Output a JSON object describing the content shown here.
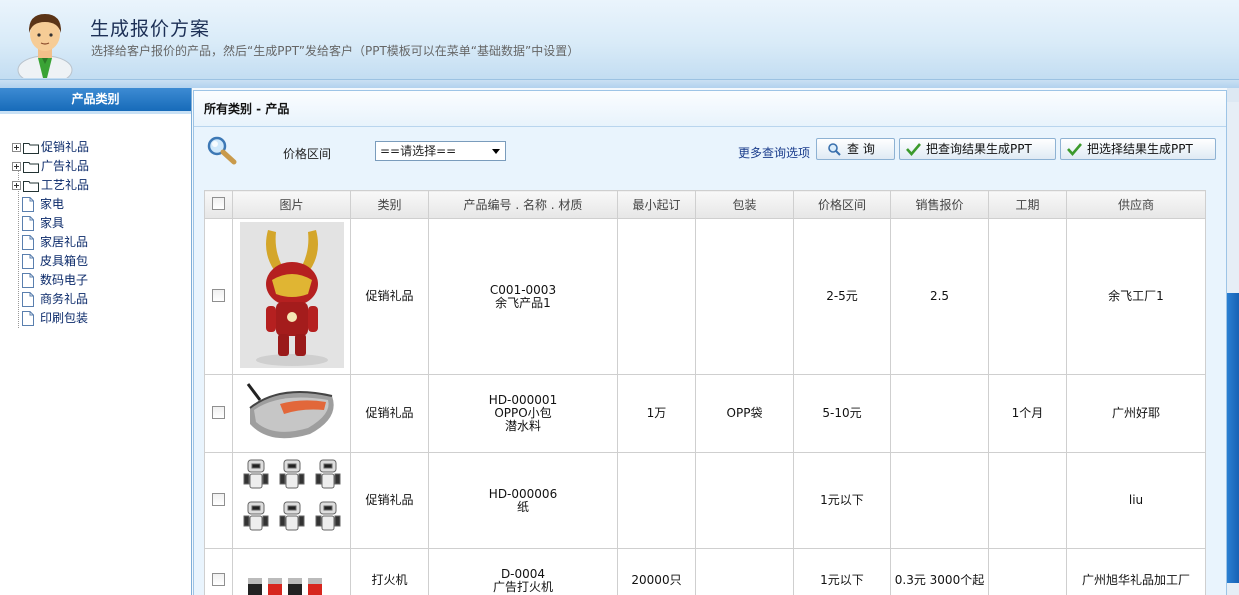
{
  "header": {
    "title": "生成报价方案",
    "subtitle": "选择给客户报价的产品，然后“生成PPT”发给客户（PPT模板可以在菜单“基础数据”中设置）"
  },
  "sidebar": {
    "title": "产品类别",
    "roots": [
      "促销礼品",
      "广告礼品",
      "工艺礼品"
    ],
    "children": [
      "家电",
      "家具",
      "家居礼品",
      "皮具箱包",
      "数码电子",
      "商务礼品",
      "印刷包装"
    ]
  },
  "main": {
    "breadcrumb": "所有类别 - 产品",
    "filter": {
      "price_label": "价格区间",
      "price_select_value": "==请选择==",
      "more_query": "更多查询选项",
      "query_button": "查 询",
      "ppt_from_query_button": "把查询结果生成PPT",
      "ppt_from_selection_button": "把选择结果生成PPT"
    },
    "table": {
      "headers": [
        "图片",
        "类别",
        "产品编号 . 名称 . 材质",
        "最小起订",
        "包装",
        "价格区间",
        "销售报价",
        "工期",
        "供应商"
      ],
      "rows": [
        {
          "category": "促销礼品",
          "code": "C001-0003",
          "name": "余飞产品1",
          "material": "",
          "moq": "",
          "packing": "",
          "price_range": "2-5元",
          "quote": "2.5",
          "period": "",
          "supplier": "余飞工厂1"
        },
        {
          "category": "促销礼品",
          "code": "HD-000001",
          "name": "OPPO小包",
          "material": "潜水料",
          "moq": "1万",
          "packing": "OPP袋",
          "price_range": "5-10元",
          "quote": "",
          "period": "1个月",
          "supplier": "广州好耶"
        },
        {
          "category": "促销礼品",
          "code": "HD-000006",
          "name": "纸",
          "material": "",
          "moq": "",
          "packing": "",
          "price_range": "1元以下",
          "quote": "",
          "period": "",
          "supplier": "liu"
        },
        {
          "category": "打火机",
          "code": "D-0004",
          "name": "广告打火机",
          "material": "",
          "moq": "20000只",
          "packing": "",
          "price_range": "1元以下",
          "quote": "0.3元 3000个起",
          "period": "",
          "supplier": "广州旭华礼品加工厂"
        }
      ]
    }
  },
  "colors": {
    "header_bg": "#d9ebf8",
    "sidebar_head_bg": "#176bb9",
    "panel_bg": "#e9f4fd",
    "link_text": "#1b3d8c"
  }
}
